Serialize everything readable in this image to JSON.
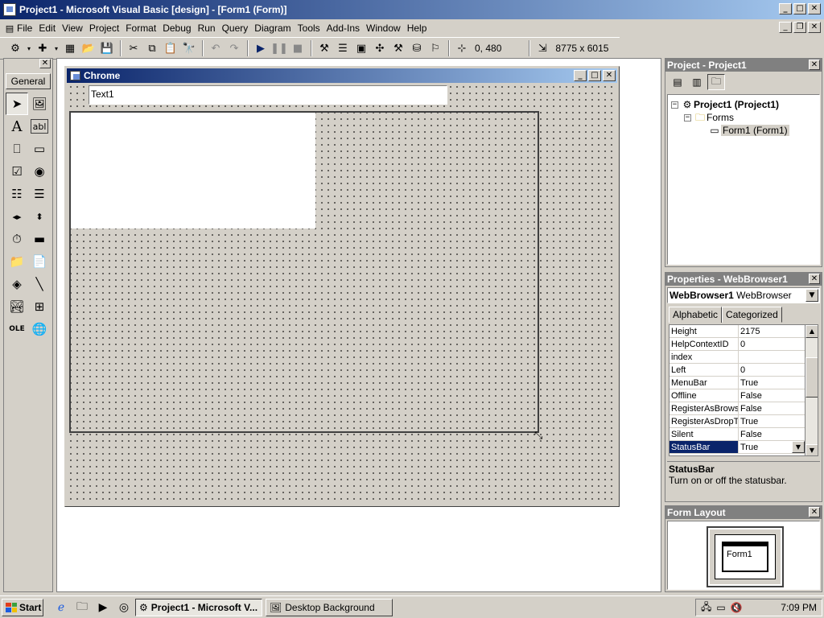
{
  "app": {
    "title": "Project1 - Microsoft Visual Basic [design] - [Form1 (Form)]"
  },
  "menu": [
    "File",
    "Edit",
    "View",
    "Project",
    "Format",
    "Debug",
    "Run",
    "Query",
    "Diagram",
    "Tools",
    "Add-Ins",
    "Window",
    "Help"
  ],
  "toolbar": {
    "position": "0, 480",
    "size": "8775 x 6015"
  },
  "toolbox": {
    "tab": "General"
  },
  "form": {
    "title": "Chrome",
    "textbox_value": "Text1"
  },
  "project": {
    "title": "Project - Project1",
    "root": "Project1 (Project1)",
    "folder": "Forms",
    "item": "Form1 (Form1)"
  },
  "properties": {
    "title": "Properties - WebBrowser1",
    "object_name": "WebBrowser1",
    "object_type": "WebBrowser",
    "tabs": [
      "Alphabetic",
      "Categorized"
    ],
    "rows": [
      {
        "name": "Height",
        "value": "2175"
      },
      {
        "name": "HelpContextID",
        "value": "0"
      },
      {
        "name": "index",
        "value": ""
      },
      {
        "name": "Left",
        "value": "0"
      },
      {
        "name": "MenuBar",
        "value": "True"
      },
      {
        "name": "Offline",
        "value": "False"
      },
      {
        "name": "RegisterAsBrowser",
        "value": "False"
      },
      {
        "name": "RegisterAsDropTarget",
        "value": "True"
      },
      {
        "name": "Silent",
        "value": "False"
      },
      {
        "name": "StatusBar",
        "value": "True"
      }
    ],
    "selected_row": "StatusBar",
    "desc_title": "StatusBar",
    "desc_text": "Turn on or off the statusbar."
  },
  "layout": {
    "title": "Form Layout",
    "form_label": "Form1"
  },
  "taskbar": {
    "start": "Start",
    "tasks": [
      "Project1 - Microsoft V...",
      "Desktop Background"
    ],
    "clock": "7:09 PM"
  }
}
